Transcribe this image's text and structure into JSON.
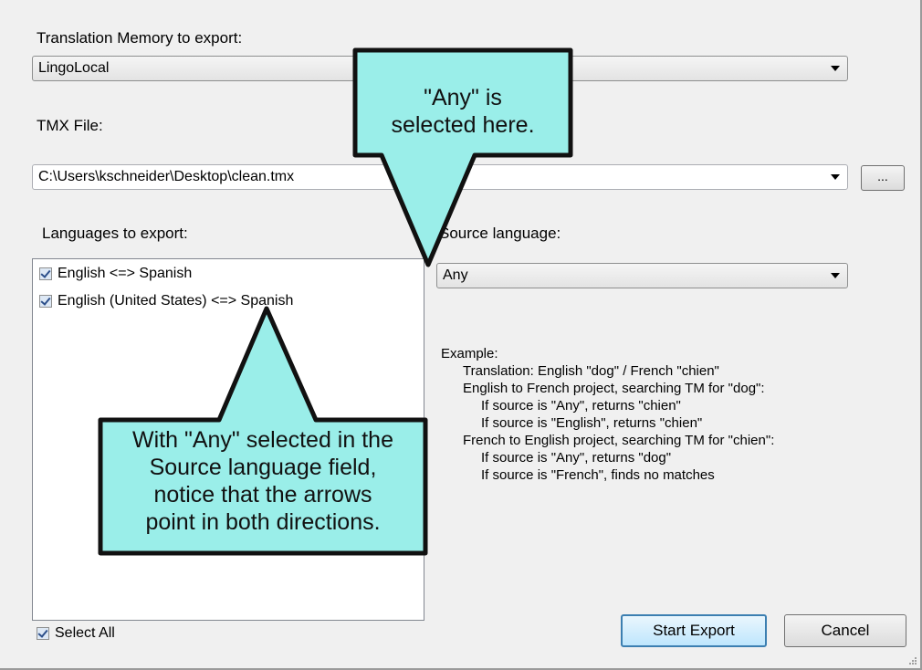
{
  "tm": {
    "label": "Translation Memory to export:",
    "value": "LingoLocal"
  },
  "tmx": {
    "label": "TMX File:",
    "value": "C:\\Users\\kschneider\\Desktop\\clean.tmx",
    "browse_label": "..."
  },
  "languages": {
    "label": "Languages to export:",
    "items": [
      {
        "label": "English <=> Spanish",
        "checked": true
      },
      {
        "label": "English (United States) <=> Spanish",
        "checked": true
      }
    ],
    "select_all_label": "Select All"
  },
  "source": {
    "label": "Source language:",
    "value": "Any"
  },
  "example": {
    "lines": [
      "Example:",
      "Translation: English \"dog\" / French \"chien\"",
      "English to French project, searching TM for \"dog\":",
      "If source is \"Any\", returns \"chien\"",
      "If source is \"English\", returns \"chien\"",
      "French to English project, searching TM for \"chien\":",
      "If source is \"Any\", returns \"dog\"",
      "If source is \"French\", finds no matches"
    ]
  },
  "buttons": {
    "start": "Start Export",
    "cancel": "Cancel"
  },
  "callouts": {
    "top": [
      "\"Any\" is",
      "selected here."
    ],
    "bottom": [
      "With \"Any\" selected in the",
      "Source language field,",
      "notice that the arrows",
      "point in both directions."
    ]
  },
  "colors": {
    "callout_fill": "#9aeee9",
    "callout_border": "#111111",
    "accent": "#3c7fb1"
  }
}
